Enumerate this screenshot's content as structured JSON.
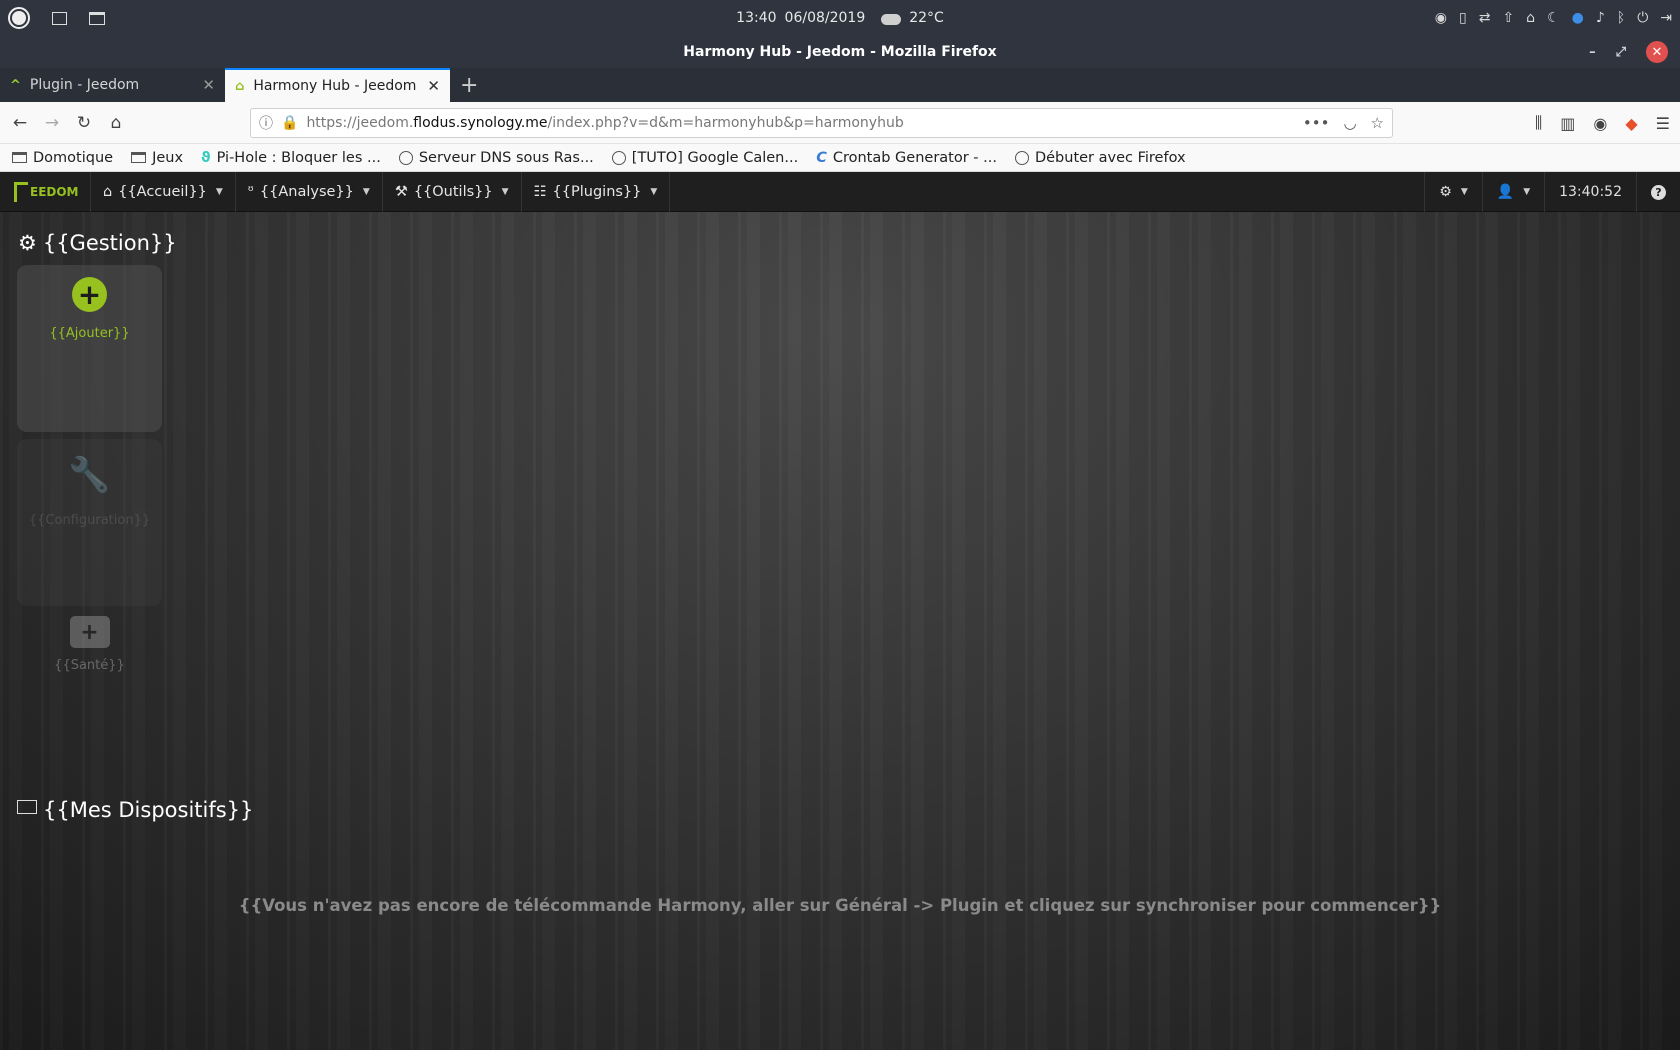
{
  "os_panel": {
    "time": "13:40",
    "date": "06/08/2019",
    "temperature": "22°C",
    "weather_icon": "cloud-icon"
  },
  "window": {
    "title": "Harmony Hub - Jeedom - Mozilla Firefox",
    "minimize": "–",
    "maximize": "⤢",
    "close": "✕"
  },
  "tabs": [
    {
      "label": "Plugin - Jeedom",
      "icon": "jeedom-favicon",
      "active": false
    },
    {
      "label": "Harmony Hub - Jeedom",
      "icon": "harmony-favicon",
      "active": true
    }
  ],
  "navbar": {
    "url_prefix": "https://jeedom.",
    "url_host": "flodus.synology.me",
    "url_path": "/index.php?v=d&m=harmonyhub&p=harmonyhub"
  },
  "bookmarks": [
    {
      "label": "Domotique",
      "icon": "folder-icon"
    },
    {
      "label": "Jeux",
      "icon": "folder-icon"
    },
    {
      "label": "Pi-Hole : Bloquer les ...",
      "icon": "pihole-icon"
    },
    {
      "label": "Serveur DNS sous Ras...",
      "icon": "globe-icon"
    },
    {
      "label": "[TUTO] Google Calen...",
      "icon": "globe-icon"
    },
    {
      "label": "Crontab Generator - ...",
      "icon": "crontab-icon"
    },
    {
      "label": "Débuter avec Firefox",
      "icon": "globe-icon"
    }
  ],
  "jeedom": {
    "logo_text": "EEDOM",
    "menu": [
      {
        "label": "{{Accueil}}",
        "icon": "home-icon"
      },
      {
        "label": "{{Analyse}}",
        "icon": "stethoscope-icon"
      },
      {
        "label": "{{Outils}}",
        "icon": "wrench-icon"
      },
      {
        "label": "{{Plugins}}",
        "icon": "tasks-icon"
      }
    ],
    "clock": "13:40:52",
    "gestion_title": "{{Gestion}}",
    "add_label": "{{Ajouter}}",
    "config_label": "{{Configuration}}",
    "sante_label": "{{Santé}}",
    "devices_title": "{{Mes Dispositifs}}",
    "empty_message": "{{Vous n'avez pas encore de télécommande Harmony, aller sur Général -> Plugin et cliquez sur synchroniser pour commencer}}"
  },
  "colors": {
    "accent_green": "#96c11f",
    "firefox_blue": "#0a84ff",
    "close_red": "#e0504e"
  }
}
